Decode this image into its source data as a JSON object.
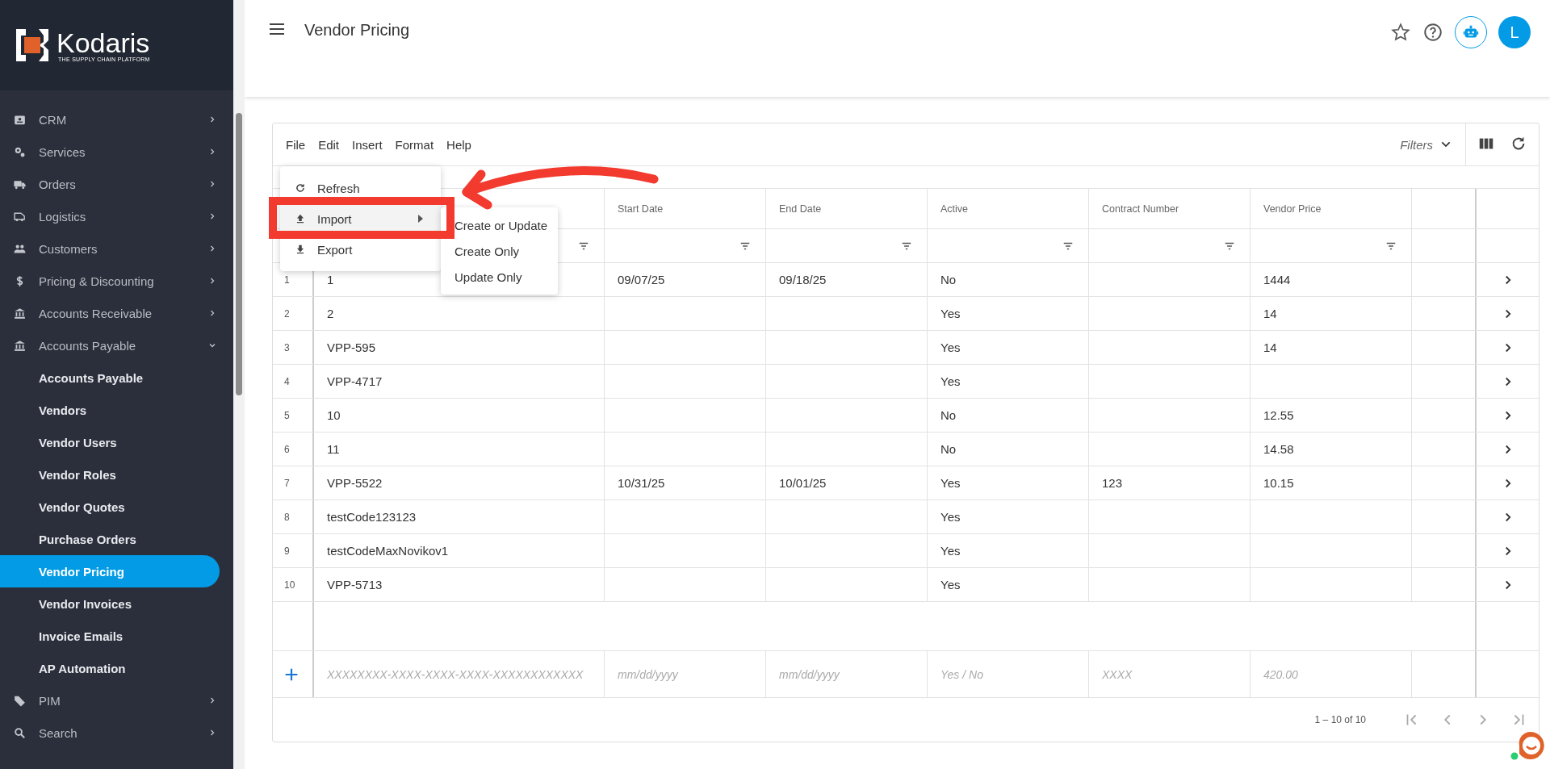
{
  "sidebar": {
    "logo": {
      "name": "Kodaris",
      "tagline": "THE SUPPLY CHAIN PLATFORM"
    },
    "items": [
      {
        "label": "CRM",
        "expanded": false
      },
      {
        "label": "Services",
        "expanded": false
      },
      {
        "label": "Orders",
        "expanded": false
      },
      {
        "label": "Logistics",
        "expanded": false
      },
      {
        "label": "Customers",
        "expanded": false
      },
      {
        "label": "Pricing & Discounting",
        "expanded": false
      },
      {
        "label": "Accounts Receivable",
        "expanded": false
      },
      {
        "label": "Accounts Payable",
        "expanded": true,
        "children": [
          {
            "label": "Accounts Payable",
            "selected": false
          },
          {
            "label": "Vendors",
            "selected": false
          },
          {
            "label": "Vendor Users",
            "selected": false
          },
          {
            "label": "Vendor Roles",
            "selected": false
          },
          {
            "label": "Vendor Quotes",
            "selected": false
          },
          {
            "label": "Purchase Orders",
            "selected": false
          },
          {
            "label": "Vendor Pricing",
            "selected": true
          },
          {
            "label": "Vendor Invoices",
            "selected": false
          },
          {
            "label": "Invoice Emails",
            "selected": false
          },
          {
            "label": "AP Automation",
            "selected": false
          }
        ]
      },
      {
        "label": "PIM",
        "expanded": false
      },
      {
        "label": "Search",
        "expanded": false
      }
    ]
  },
  "header": {
    "title": "Vendor Pricing",
    "avatar": "L"
  },
  "menubar": [
    "File",
    "Edit",
    "Insert",
    "Format",
    "Help"
  ],
  "file_menu": [
    {
      "label": "Refresh",
      "selected": false
    },
    {
      "label": "Import",
      "selected": true
    },
    {
      "label": "Export",
      "selected": false
    }
  ],
  "import_submenu": [
    "Create or Update",
    "Create Only",
    "Update Only"
  ],
  "toolbar": {
    "filters": "Filters"
  },
  "table": {
    "columns": [
      "Start Date",
      "End Date",
      "Active",
      "Contract Number",
      "Vendor Price"
    ],
    "rows": [
      {
        "num": "1",
        "code": "1",
        "start_date": "09/07/25",
        "end_date": "09/18/25",
        "active": "No",
        "vendor_price": "1444"
      },
      {
        "num": "2",
        "code": "2",
        "active": "Yes",
        "vendor_price": "14"
      },
      {
        "num": "3",
        "code": "VPP-595",
        "active": "Yes",
        "vendor_price": "14"
      },
      {
        "num": "4",
        "code": "VPP-4717",
        "active": "Yes"
      },
      {
        "num": "5",
        "code": "10",
        "active": "No",
        "vendor_price": "12.55"
      },
      {
        "num": "6",
        "code": "11",
        "active": "No",
        "vendor_price": "14.58"
      },
      {
        "num": "7",
        "code": "VPP-5522",
        "start_date": "10/31/25",
        "end_date": "10/01/25",
        "active": "Yes",
        "contract_number": "123",
        "vendor_price": "10.15"
      },
      {
        "num": "8",
        "code": "testCode123123",
        "active": "Yes"
      },
      {
        "num": "9",
        "code": "testCodeMaxNovikov1",
        "active": "Yes"
      },
      {
        "num": "10",
        "code": "VPP-5713",
        "active": "Yes"
      }
    ],
    "new_row": {
      "code": "XXXXXXXX-XXXX-XXXX-XXXX-XXXXXXXXXXXX",
      "start_date": "mm/dd/yyyy",
      "end_date": "mm/dd/yyyy",
      "active": "Yes / No",
      "contract_number": "XXXX",
      "vendor_price": "420.00"
    },
    "pagination": "1 – 10 of 10"
  }
}
